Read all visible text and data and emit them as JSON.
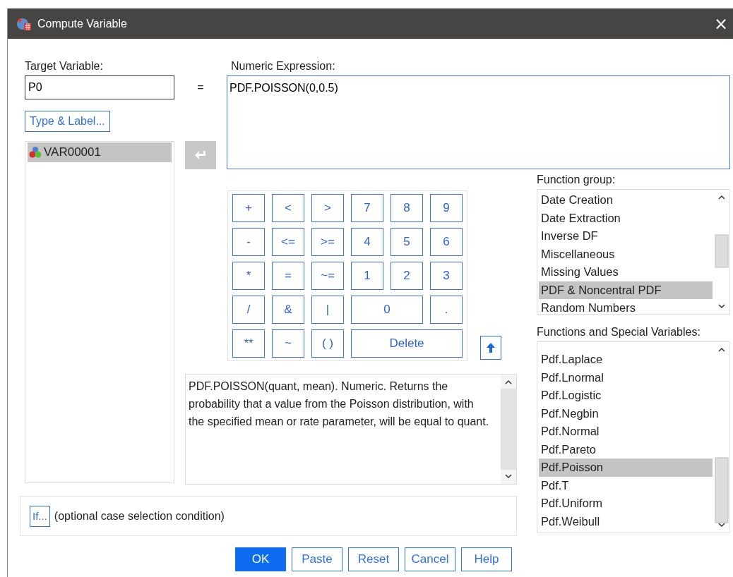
{
  "window": {
    "title": "Compute Variable",
    "close": "×"
  },
  "target": {
    "label": "Target Variable:",
    "value": "P0"
  },
  "equals": "=",
  "expression": {
    "label": "Numeric Expression:",
    "value": "PDF.POISSON(0,0.5)"
  },
  "type_label_button": "Type & Label...",
  "variables": [
    {
      "name": "VAR00001",
      "selected": true
    }
  ],
  "keypad": [
    {
      "label": "+",
      "kind": "single"
    },
    {
      "label": "<",
      "kind": "single"
    },
    {
      "label": ">",
      "kind": "single"
    },
    {
      "label": "7",
      "kind": "single"
    },
    {
      "label": "8",
      "kind": "single"
    },
    {
      "label": "9",
      "kind": "single"
    },
    {
      "label": "-",
      "kind": "single"
    },
    {
      "label": "<=",
      "kind": "single"
    },
    {
      "label": ">=",
      "kind": "single"
    },
    {
      "label": "4",
      "kind": "single"
    },
    {
      "label": "5",
      "kind": "single"
    },
    {
      "label": "6",
      "kind": "single"
    },
    {
      "label": "*",
      "kind": "single"
    },
    {
      "label": "=",
      "kind": "single"
    },
    {
      "label": "~=",
      "kind": "single"
    },
    {
      "label": "1",
      "kind": "single"
    },
    {
      "label": "2",
      "kind": "single"
    },
    {
      "label": "3",
      "kind": "single"
    },
    {
      "label": "/",
      "kind": "single"
    },
    {
      "label": "&",
      "kind": "single"
    },
    {
      "label": "|",
      "kind": "single"
    },
    {
      "label": "0",
      "kind": "double"
    },
    {
      "label": ".",
      "kind": "single"
    },
    {
      "label": "**",
      "kind": "single"
    },
    {
      "label": "~",
      "kind": "single"
    },
    {
      "label": "( )",
      "kind": "single"
    },
    {
      "label": "Delete",
      "kind": "triple"
    }
  ],
  "description": "PDF.POISSON(quant, mean). Numeric. Returns the probability that a value from the Poisson distribution, with the specified mean or rate parameter, will be equal to quant.",
  "function_group": {
    "label": "Function group:",
    "items": [
      {
        "name": "Date Creation",
        "selected": false
      },
      {
        "name": "Date Extraction",
        "selected": false
      },
      {
        "name": "Inverse DF",
        "selected": false
      },
      {
        "name": "Miscellaneous",
        "selected": false
      },
      {
        "name": "Missing Values",
        "selected": false
      },
      {
        "name": "PDF & Noncentral PDF",
        "selected": true
      },
      {
        "name": "Random Numbers",
        "selected": false
      }
    ]
  },
  "functions": {
    "label": "Functions and Special Variables:",
    "items": [
      {
        "name": "Pdf.Laplace",
        "selected": false
      },
      {
        "name": "Pdf.Lnormal",
        "selected": false
      },
      {
        "name": "Pdf.Logistic",
        "selected": false
      },
      {
        "name": "Pdf.Negbin",
        "selected": false
      },
      {
        "name": "Pdf.Normal",
        "selected": false
      },
      {
        "name": "Pdf.Pareto",
        "selected": false
      },
      {
        "name": "Pdf.Poisson",
        "selected": true
      },
      {
        "name": "Pdf.T",
        "selected": false
      },
      {
        "name": "Pdf.Uniform",
        "selected": false
      },
      {
        "name": "Pdf.Weibull",
        "selected": false
      }
    ]
  },
  "if_condition": {
    "button": "If...",
    "text": "(optional case selection condition)"
  },
  "buttons": [
    {
      "label": "OK",
      "kind": "primary"
    },
    {
      "label": "Paste",
      "kind": "normal"
    },
    {
      "label": "Reset",
      "kind": "normal"
    },
    {
      "label": "Cancel",
      "kind": "normal"
    },
    {
      "label": "Help",
      "kind": "normal"
    }
  ]
}
